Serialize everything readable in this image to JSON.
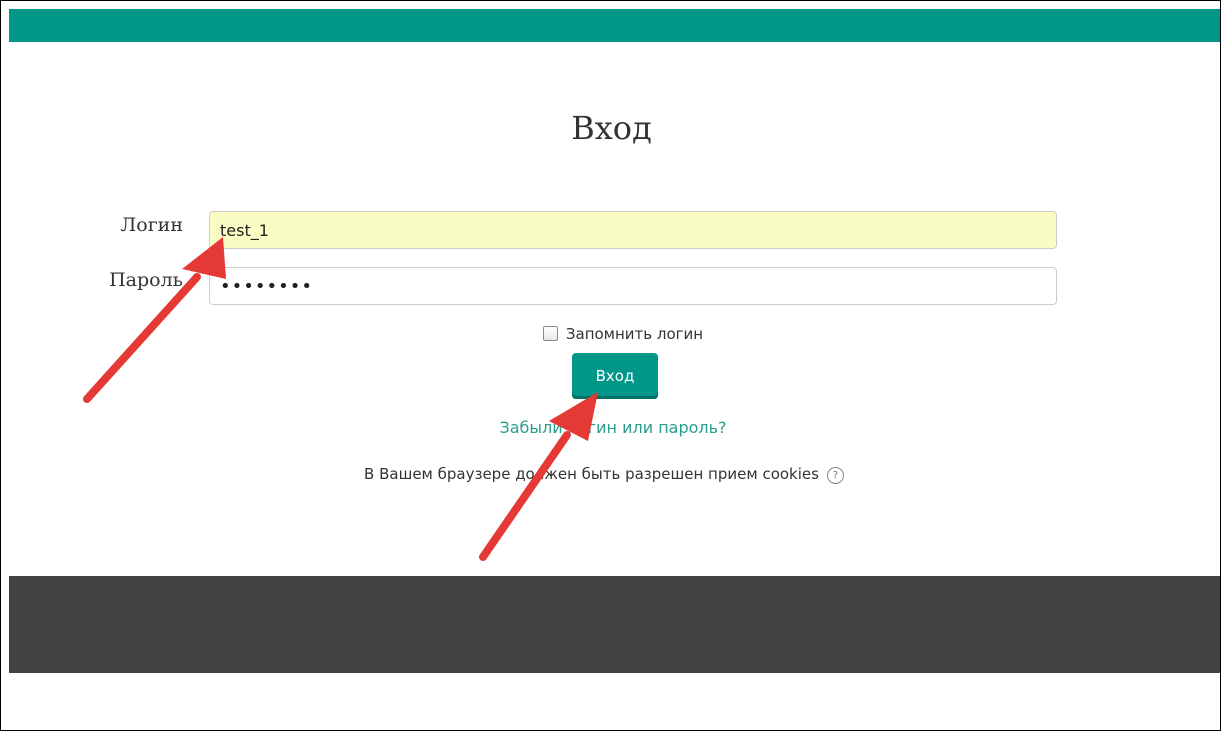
{
  "page": {
    "title": "Вход"
  },
  "form": {
    "username_label": "Логин",
    "username_value": "test_1",
    "password_label": "Пароль",
    "password_value": "••••••••",
    "remember_label": "Запомнить логин",
    "submit_label": "Вход",
    "forgot_link": "Забыли логин или пароль?",
    "cookies_notice": "В Вашем браузере должен быть разрешен прием cookies",
    "help_icon_glyph": "?"
  },
  "colors": {
    "accent": "#009688",
    "footer": "#424242",
    "autofill": "#fafdc3",
    "annotation_arrow": "#e53935"
  },
  "icons": {
    "help": "question-circle-icon",
    "annotation": "arrow-icon"
  }
}
